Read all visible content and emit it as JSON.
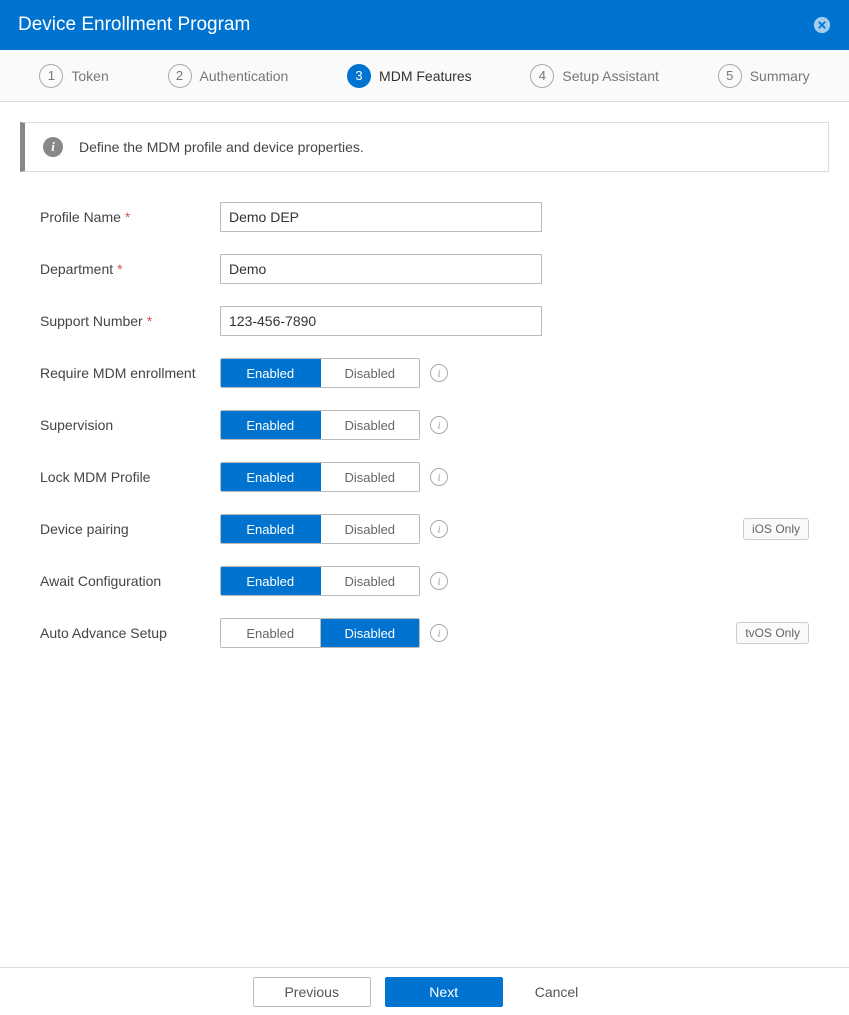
{
  "header": {
    "title": "Device Enrollment Program"
  },
  "steps": [
    {
      "num": "1",
      "label": "Token",
      "active": false
    },
    {
      "num": "2",
      "label": "Authentication",
      "active": false
    },
    {
      "num": "3",
      "label": "MDM Features",
      "active": true
    },
    {
      "num": "4",
      "label": "Setup Assistant",
      "active": false
    },
    {
      "num": "5",
      "label": "Summary",
      "active": false
    }
  ],
  "info_banner": "Define the MDM profile and device properties.",
  "form": {
    "profile_name": {
      "label": "Profile Name",
      "required": true,
      "value": "Demo DEP"
    },
    "department": {
      "label": "Department",
      "required": true,
      "value": "Demo"
    },
    "support_number": {
      "label": "Support Number",
      "required": true,
      "value": "123-456-7890"
    },
    "require_mdm": {
      "label": "Require MDM enrollment",
      "enabled_label": "Enabled",
      "disabled_label": "Disabled",
      "value": "enabled"
    },
    "supervision": {
      "label": "Supervision",
      "enabled_label": "Enabled",
      "disabled_label": "Disabled",
      "value": "enabled"
    },
    "lock_profile": {
      "label": "Lock MDM Profile",
      "enabled_label": "Enabled",
      "disabled_label": "Disabled",
      "value": "enabled"
    },
    "device_pairing": {
      "label": "Device pairing",
      "enabled_label": "Enabled",
      "disabled_label": "Disabled",
      "value": "enabled",
      "badge": "iOS Only"
    },
    "await_config": {
      "label": "Await Configuration",
      "enabled_label": "Enabled",
      "disabled_label": "Disabled",
      "value": "enabled"
    },
    "auto_advance": {
      "label": "Auto Advance Setup",
      "enabled_label": "Enabled",
      "disabled_label": "Disabled",
      "value": "disabled",
      "badge": "tvOS Only"
    }
  },
  "footer": {
    "previous": "Previous",
    "next": "Next",
    "cancel": "Cancel"
  }
}
